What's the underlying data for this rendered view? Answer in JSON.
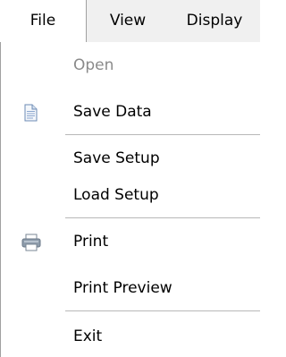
{
  "menubar": {
    "tabs": [
      {
        "label": "File"
      },
      {
        "label": "View"
      },
      {
        "label": "Display"
      }
    ]
  },
  "file_menu": {
    "items": [
      {
        "label": "Open",
        "enabled": false
      },
      {
        "label": "Save Data",
        "icon": "document-icon"
      },
      {
        "label": "Save Setup"
      },
      {
        "label": "Load Setup"
      },
      {
        "label": "Print",
        "icon": "printer-icon"
      },
      {
        "label": "Print Preview"
      },
      {
        "label": "Exit"
      }
    ]
  }
}
